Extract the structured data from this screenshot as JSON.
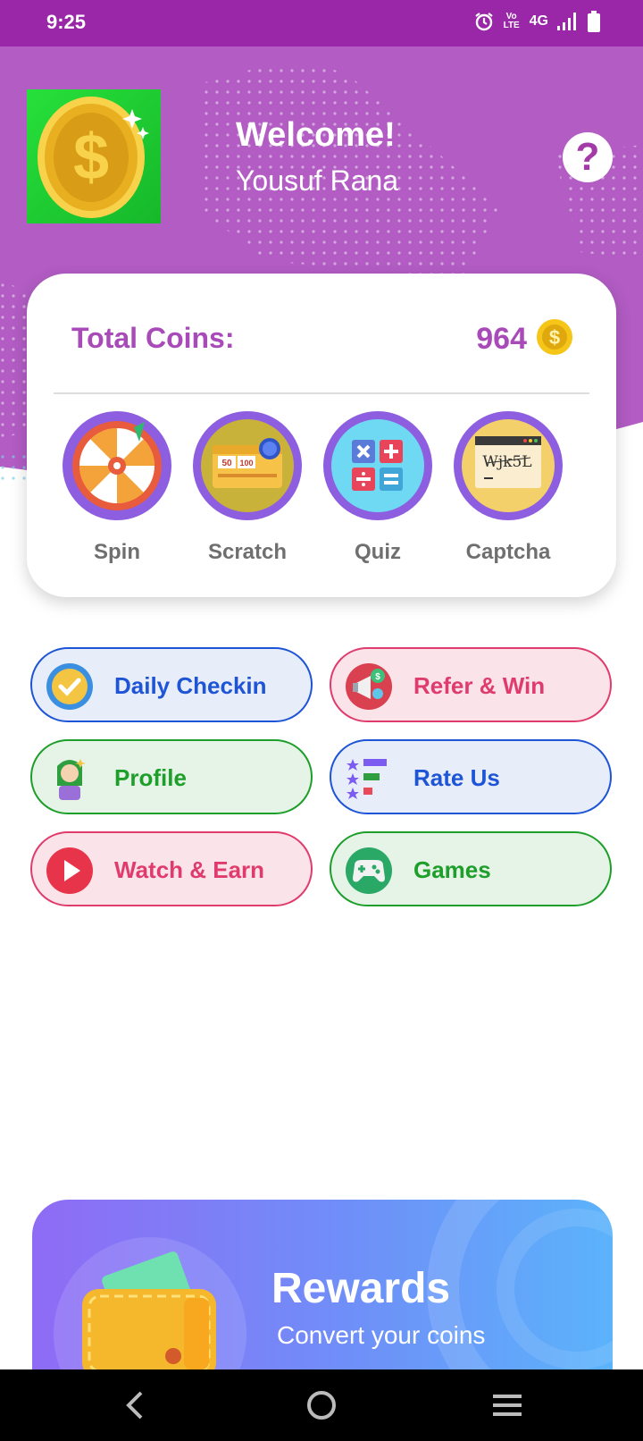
{
  "status_bar": {
    "time": "9:25",
    "network": "4G",
    "volte": "Vo LTE"
  },
  "header": {
    "welcome": "Welcome!",
    "user_name": "Yousuf Rana",
    "help_glyph": "?"
  },
  "card": {
    "coins_label": "Total Coins:",
    "coins_value": "964",
    "coin_glyph": "$",
    "features": [
      {
        "label": "Spin",
        "icon": "spin-wheel-icon"
      },
      {
        "label": "Scratch",
        "icon": "scratch-card-icon"
      },
      {
        "label": "Quiz",
        "icon": "quiz-icon"
      },
      {
        "label": "Captcha",
        "icon": "captcha-icon",
        "captcha_text": "Wjk5L"
      }
    ],
    "scratch_numbers": [
      "50",
      "100"
    ]
  },
  "actions": [
    {
      "label": "Daily Checkin",
      "icon": "check-badge-icon",
      "style": "blue"
    },
    {
      "label": "Refer & Win",
      "icon": "megaphone-icon",
      "style": "pink"
    },
    {
      "label": "Profile",
      "icon": "profile-icon",
      "style": "green"
    },
    {
      "label": "Rate Us",
      "icon": "rating-icon",
      "style": "blue"
    },
    {
      "label": "Watch & Earn",
      "icon": "play-icon",
      "style": "pink"
    },
    {
      "label": "Games",
      "icon": "gamepad-icon",
      "style": "green"
    }
  ],
  "rewards": {
    "title": "Rewards",
    "subtitle": "Convert your coins"
  },
  "colors": {
    "header": "#b25cc4",
    "status_bar": "#9a26a8",
    "accent_purple": "#a84bb8",
    "blue": "#1e54d6",
    "pink": "#df3c6d",
    "green": "#1e9e2a"
  }
}
